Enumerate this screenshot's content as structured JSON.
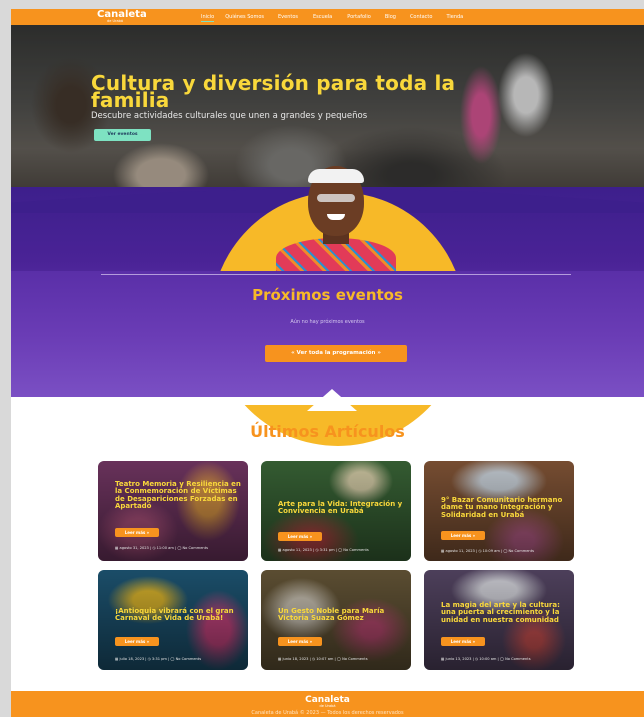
{
  "brand": {
    "logo": "Canaleta",
    "logo_sub": "de Urabá"
  },
  "nav": {
    "items": [
      "Inicio",
      "Quiénes Somos",
      "Eventos",
      "Escuela",
      "Portafolio",
      "Blog",
      "Contacto",
      "Tienda"
    ]
  },
  "hero": {
    "title": "Cultura y diversión para toda la familia",
    "subtitle": "Descubre actividades culturales que unen a grandes y pequeños",
    "button": "Ver eventos"
  },
  "events": {
    "title": "Próximos eventos",
    "empty": "Aún no hay próximos eventos",
    "button": "« Ver toda la programación »"
  },
  "articles": {
    "title": "Últimos Artículos",
    "read_more": "Leer más »",
    "cards": [
      {
        "title": "Teatro Memoria y Resiliencia en la Conmemoración de Víctimas de Desapariciones Forzadas en Apartadó",
        "meta": "▦ agosto 31, 2023 | ◷ 11:00 am | ◯ No Comments",
        "bg": "#7a3a6a"
      },
      {
        "title": "Arte para la Vida: Integración y Convivencia en Urabá",
        "meta": "▦ agosto 11, 2023 | ◷ 3:31 pm | ◯ No Comments",
        "bg": "#3d6b3a"
      },
      {
        "title": "9° Bazar Comunitario hermano dame tu mano Integración y Solidaridad en Urabá",
        "meta": "▦ agosto 11, 2023 | ◷ 10:09 am | ◯ No Comments",
        "bg": "#8a5a3a"
      },
      {
        "title": "¡Antioquia vibrará con el gran Carnaval de Vida de Urabá!",
        "meta": "▦ julio 18, 2023 | ◷ 3:31 pm | ◯ No Comments",
        "bg": "#1f5a7a"
      },
      {
        "title": "Un Gesto Noble para María Victoria Suaza Gómez",
        "meta": "▦ junio 18, 2023 | ◷ 10:07 am | ◯ No Comments",
        "bg": "#6a5a3a"
      },
      {
        "title": "La magia del arte y la cultura: una puerta al crecimiento y la unidad en nuestra comunidad",
        "meta": "▦ junio 13, 2023 | ◷ 10:00 am | ◯ No Comments",
        "bg": "#5a4a6a"
      }
    ]
  },
  "footer": {
    "logo": "Canaleta",
    "logo_sub": "de Urabá",
    "copyright": "Canaleta de Urabá © 2023 — Todos los derechos reservados"
  }
}
